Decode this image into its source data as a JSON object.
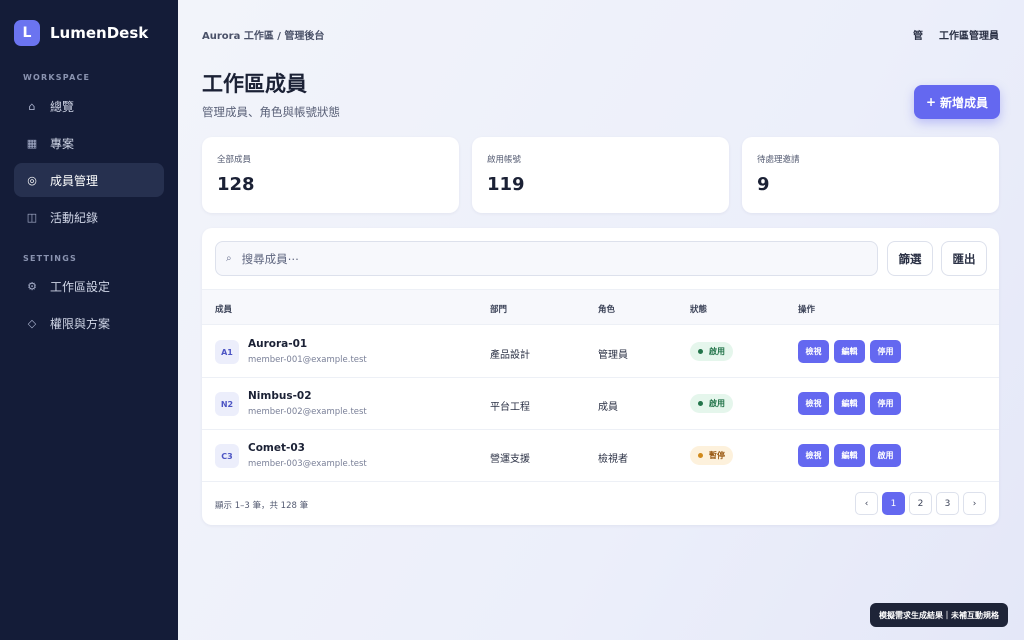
{
  "app": {
    "name": "LumenDesk",
    "logo_letter": "L"
  },
  "sidebar": {
    "workspace_label": "WORKSPACE",
    "settings_label": "SETTINGS",
    "items": [
      {
        "label": "總覽",
        "icon": "home-icon"
      },
      {
        "label": "專案",
        "icon": "grid-icon"
      },
      {
        "label": "成員管理",
        "icon": "members-icon",
        "active": true
      },
      {
        "label": "活動紀錄",
        "icon": "book-icon"
      },
      {
        "label": "工作區設定",
        "icon": "gear-icon"
      },
      {
        "label": "權限與方案",
        "icon": "diamond-icon"
      }
    ]
  },
  "header": {
    "breadcrumb": "Aurora 工作區 / 管理後台",
    "user_avatar": "管",
    "user_name": "工作區管理員"
  },
  "page": {
    "title": "工作區成員",
    "subtitle": "管理成員、角色與帳號狀態",
    "add_button": "新增成員",
    "add_icon": "+"
  },
  "stats": [
    {
      "label": "全部成員",
      "value": "128"
    },
    {
      "label": "啟用帳號",
      "value": "119"
    },
    {
      "label": "待處理邀請",
      "value": "9"
    }
  ],
  "toolbar": {
    "search_placeholder": "搜尋成員⋯",
    "filter_label": "篩選",
    "export_label": "匯出"
  },
  "table": {
    "columns": [
      "成員",
      "部門",
      "角色",
      "狀態",
      "操作"
    ],
    "rows": [
      {
        "initials": "A1",
        "name": "Aurora-01",
        "email": "member-001@example.test",
        "dept": "產品設計",
        "role": "管理員",
        "status": "啟用",
        "status_type": "ok",
        "actions": [
          "檢視",
          "編輯",
          "停用"
        ]
      },
      {
        "initials": "N2",
        "name": "Nimbus-02",
        "email": "member-002@example.test",
        "dept": "平台工程",
        "role": "成員",
        "status": "啟用",
        "status_type": "ok",
        "actions": [
          "檢視",
          "編輯",
          "停用"
        ]
      },
      {
        "initials": "C3",
        "name": "Comet-03",
        "email": "member-003@example.test",
        "dept": "營運支援",
        "role": "檢視者",
        "status": "暫停",
        "status_type": "pause",
        "actions": [
          "檢視",
          "編輯",
          "啟用"
        ]
      }
    ]
  },
  "pagination": {
    "info": "顯示 1–3 筆，共 128 筆",
    "prev": "‹",
    "next": "›",
    "pages": [
      "1",
      "2",
      "3"
    ],
    "current": "1"
  },
  "toast": "模擬需求生成結果｜未補互動規格",
  "colors": {
    "accent": "#6468f0",
    "sidebar": "#141c38"
  }
}
